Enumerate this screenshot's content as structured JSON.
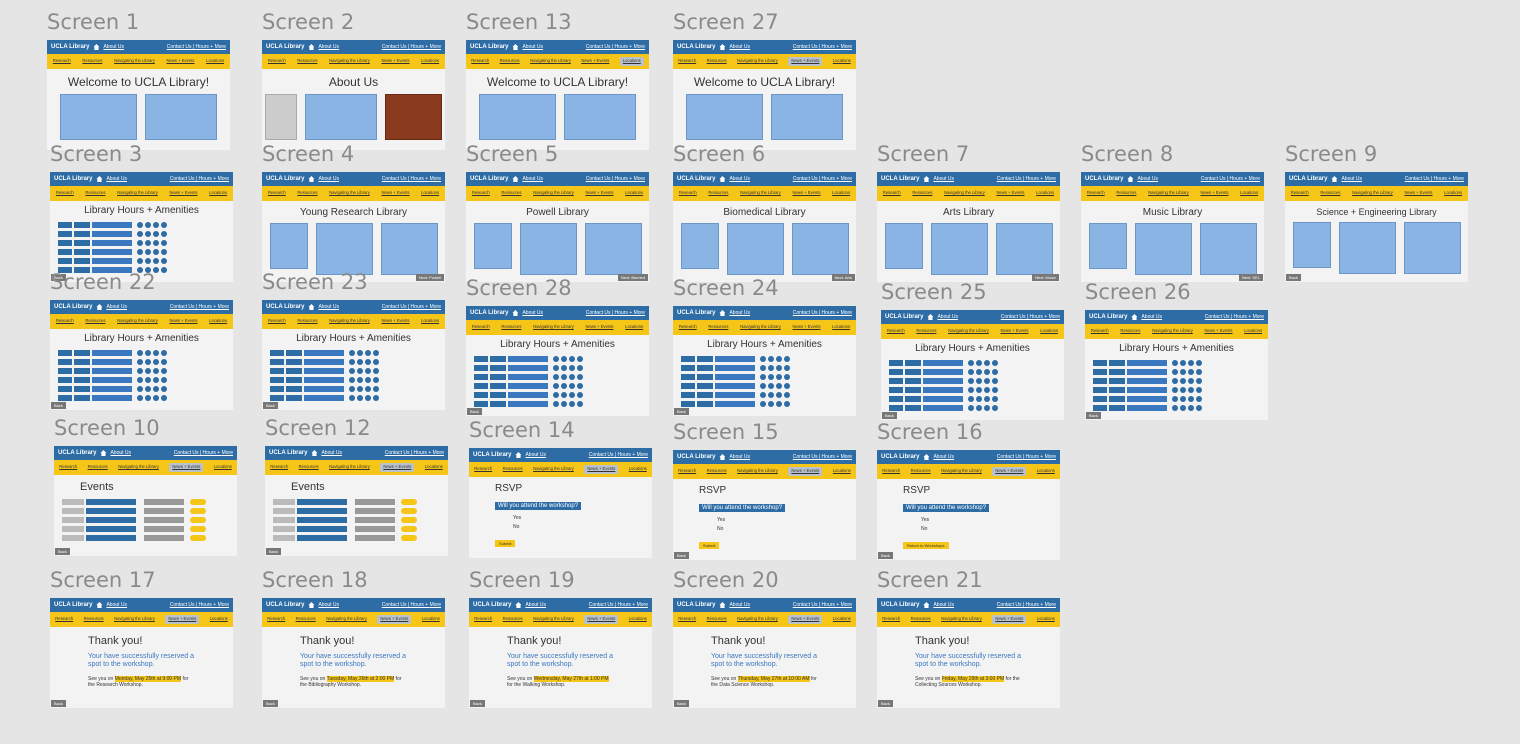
{
  "labels": {
    "s1": "Screen 1",
    "s2": "Screen 2",
    "s13": "Screen 13",
    "s27": "Screen 27",
    "s3": "Screen 3",
    "s4": "Screen 4",
    "s5": "Screen 5",
    "s6": "Screen 6",
    "s7": "Screen 7",
    "s8": "Screen 8",
    "s9": "Screen 9",
    "s22": "Screen 22",
    "s23": "Screen 23",
    "s28": "Screen 28",
    "s24": "Screen 24",
    "s25": "Screen 25",
    "s26": "Screen 26",
    "s10": "Screen 10",
    "s12": "Screen 12",
    "s14": "Screen 14",
    "s15": "Screen 15",
    "s16": "Screen 16",
    "s17": "Screen 17",
    "s18": "Screen 18",
    "s19": "Screen 19",
    "s20": "Screen 20",
    "s21": "Screen 21"
  },
  "common": {
    "brand": "UCLA Library",
    "about": "About Us",
    "contact": "Contact Us | Hours + More",
    "nav": [
      "Research",
      "Resources",
      "Navigating the Library",
      "News + Events",
      "Locations"
    ],
    "back": "Back"
  },
  "titles": {
    "welcome": "Welcome to UCLA Library!",
    "about": "About Us",
    "hours": "Library Hours + Amenities",
    "yrl": "Young Research Library",
    "powell": "Powell Library",
    "bio": "Biomedical Library",
    "arts": "Arts Library",
    "music": "Music Library",
    "sci": "Science + Engineering Library",
    "events": "Events",
    "rsvp": "RSVP",
    "thanks": "Thank you!"
  },
  "rsvp": {
    "question": "Will you attend the workshop?",
    "yes": "Yes",
    "no": "No",
    "submit": "Submit",
    "ret": "Return to Workshops"
  },
  "thanks": {
    "msg": "Your have successfully reserved a spot to the workshop.",
    "see": "See you on",
    "d17": "Monday, May 25th at 9:00 PM",
    "w17": "for the Research Workshop.",
    "d18": "Tuesday, May 26th at 2:00 PM",
    "w18": "for the Bibliography Workshop.",
    "d19": "Wednesday, May 27th at 1:00 PM",
    "w19": "for the Walking Workshop.",
    "d20": "Thursday, May 27th at 10:00 AM",
    "w20": "for the Data Science Workshop.",
    "d21": "Friday, May 29th at 3:00 PM",
    "w21": "for the Collecting Sources Workshop."
  },
  "next": {
    "s4": "Next: Powell",
    "s5": "Next: Biomed",
    "s6": "Next: Arts",
    "s7": "Next: Music",
    "s8": "Next: SEL"
  }
}
